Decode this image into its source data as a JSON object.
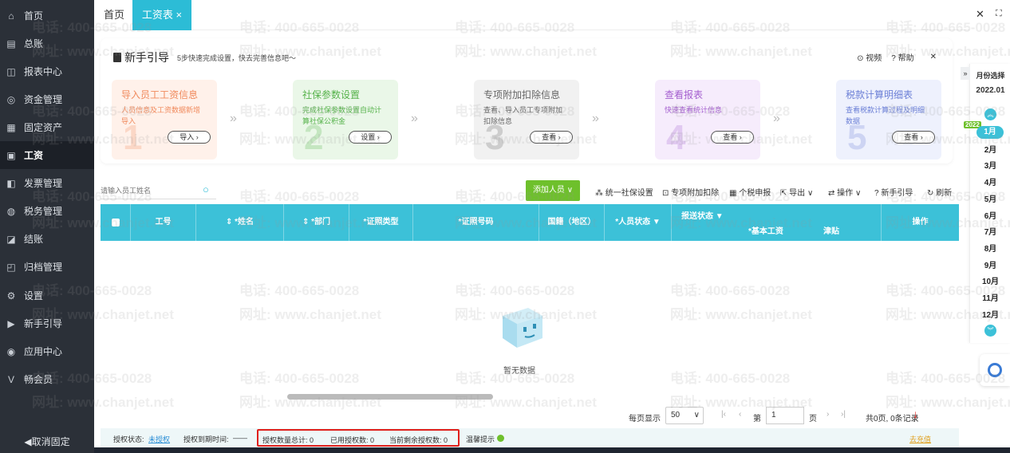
{
  "sidebar": {
    "items": [
      {
        "label": "首页",
        "icon": "home-icon",
        "glyph": "⌂"
      },
      {
        "label": "总账",
        "icon": "ledger-icon",
        "glyph": "▤"
      },
      {
        "label": "报表中心",
        "icon": "chart-icon",
        "glyph": "◫"
      },
      {
        "label": "资金管理",
        "icon": "money-icon",
        "glyph": "◎"
      },
      {
        "label": "固定资产",
        "icon": "asset-icon",
        "glyph": "▦"
      },
      {
        "label": "工资",
        "icon": "salary-icon",
        "glyph": "▣"
      },
      {
        "label": "发票管理",
        "icon": "invoice-icon",
        "glyph": "◧"
      },
      {
        "label": "税务管理",
        "icon": "tax-icon",
        "glyph": "◍"
      },
      {
        "label": "结账",
        "icon": "close-books-icon",
        "glyph": "◪"
      },
      {
        "label": "归档管理",
        "icon": "archive-icon",
        "glyph": "◰"
      },
      {
        "label": "设置",
        "icon": "gear-icon",
        "glyph": "⚙"
      },
      {
        "label": "新手引导",
        "icon": "guide-icon",
        "glyph": "▶"
      },
      {
        "label": "应用中心",
        "icon": "apps-icon",
        "glyph": "◉"
      },
      {
        "label": "畅会员",
        "icon": "vip-icon",
        "glyph": "V"
      }
    ],
    "unpin": "◀取消固定",
    "active_index": 5
  },
  "tabs": {
    "home": "首页",
    "salary": "工资表",
    "close": "×"
  },
  "window": {
    "close": "✕",
    "maximize": "⛶"
  },
  "guide": {
    "title": "新手引导",
    "subtitle": "5步快速完成设置，快去完善信息吧～",
    "video": "视频",
    "help": "帮助",
    "close": "✕",
    "steps": [
      {
        "title": "导入员工工资信息",
        "desc": "人员信息及工资数据新增导入",
        "button": "导入",
        "num": "1",
        "color": "#f08a5d",
        "bg": "#fff1ea"
      },
      {
        "title": "社保参数设置",
        "desc": "完成社保参数设置自动计算社保公积金",
        "button": "设置",
        "num": "2",
        "color": "#55b24a",
        "bg": "#eaf7e8"
      },
      {
        "title": "专项附加扣除信息",
        "desc": "查看、导入员工专项附加扣除信息",
        "button": "查看",
        "num": "3",
        "color": "#666666",
        "bg": "#f1f1f1"
      },
      {
        "title": "查看报表",
        "desc": "快速查看统计信息",
        "button": "查看",
        "num": "4",
        "color": "#a45fcf",
        "bg": "#f6ecfc"
      },
      {
        "title": "税款计算明细表",
        "desc": "查看税款计算过程及明细数据",
        "button": "查看",
        "num": "5",
        "color": "#6b7fd6",
        "bg": "#eef1fd"
      }
    ]
  },
  "toolbar": {
    "search_placeholder": "请输入员工姓名",
    "add": "添加人员 ∨",
    "social": "统一社保设置",
    "deduction": "专项附加扣除",
    "tax_report": "个税申报",
    "export": "导出 ∨",
    "ops": "操作 ∨",
    "guide": "新手引导",
    "refresh": "刷新"
  },
  "table": {
    "headers": [
      "工号",
      "*姓名",
      "*部门",
      "*证照类型",
      "*证照号码",
      "国籍（地区）",
      "*人员状态",
      "报送状态",
      "*基本工资",
      "津贴",
      "操作"
    ],
    "empty": "暂无数据"
  },
  "pager": {
    "per_page_label": "每页显示",
    "per_page": "50",
    "page_label": "第",
    "page": "1",
    "page_unit": "页",
    "summary": "共0页, 0条记录"
  },
  "status": {
    "auth_state_label": "授权状态:",
    "auth_state": "未授权",
    "expire_label": "授权到期时间:",
    "expire": "——",
    "total": "授权数量总计: 0",
    "used": "已用授权数: 0",
    "remain": "当前剩余授权数: 0",
    "tip": "温馨提示",
    "recharge": "去充值"
  },
  "months": {
    "header": "月份选择",
    "year": "2022.01",
    "badge": "2022",
    "list": [
      "1月",
      "2月",
      "3月",
      "4月",
      "5月",
      "6月",
      "7月",
      "8月",
      "9月",
      "10月",
      "11月",
      "12月"
    ]
  },
  "colors": {
    "accent": "#2cbcd6",
    "green": "#6ec02c",
    "sidebar": "#2b3038",
    "highlight": "#e0201c"
  }
}
